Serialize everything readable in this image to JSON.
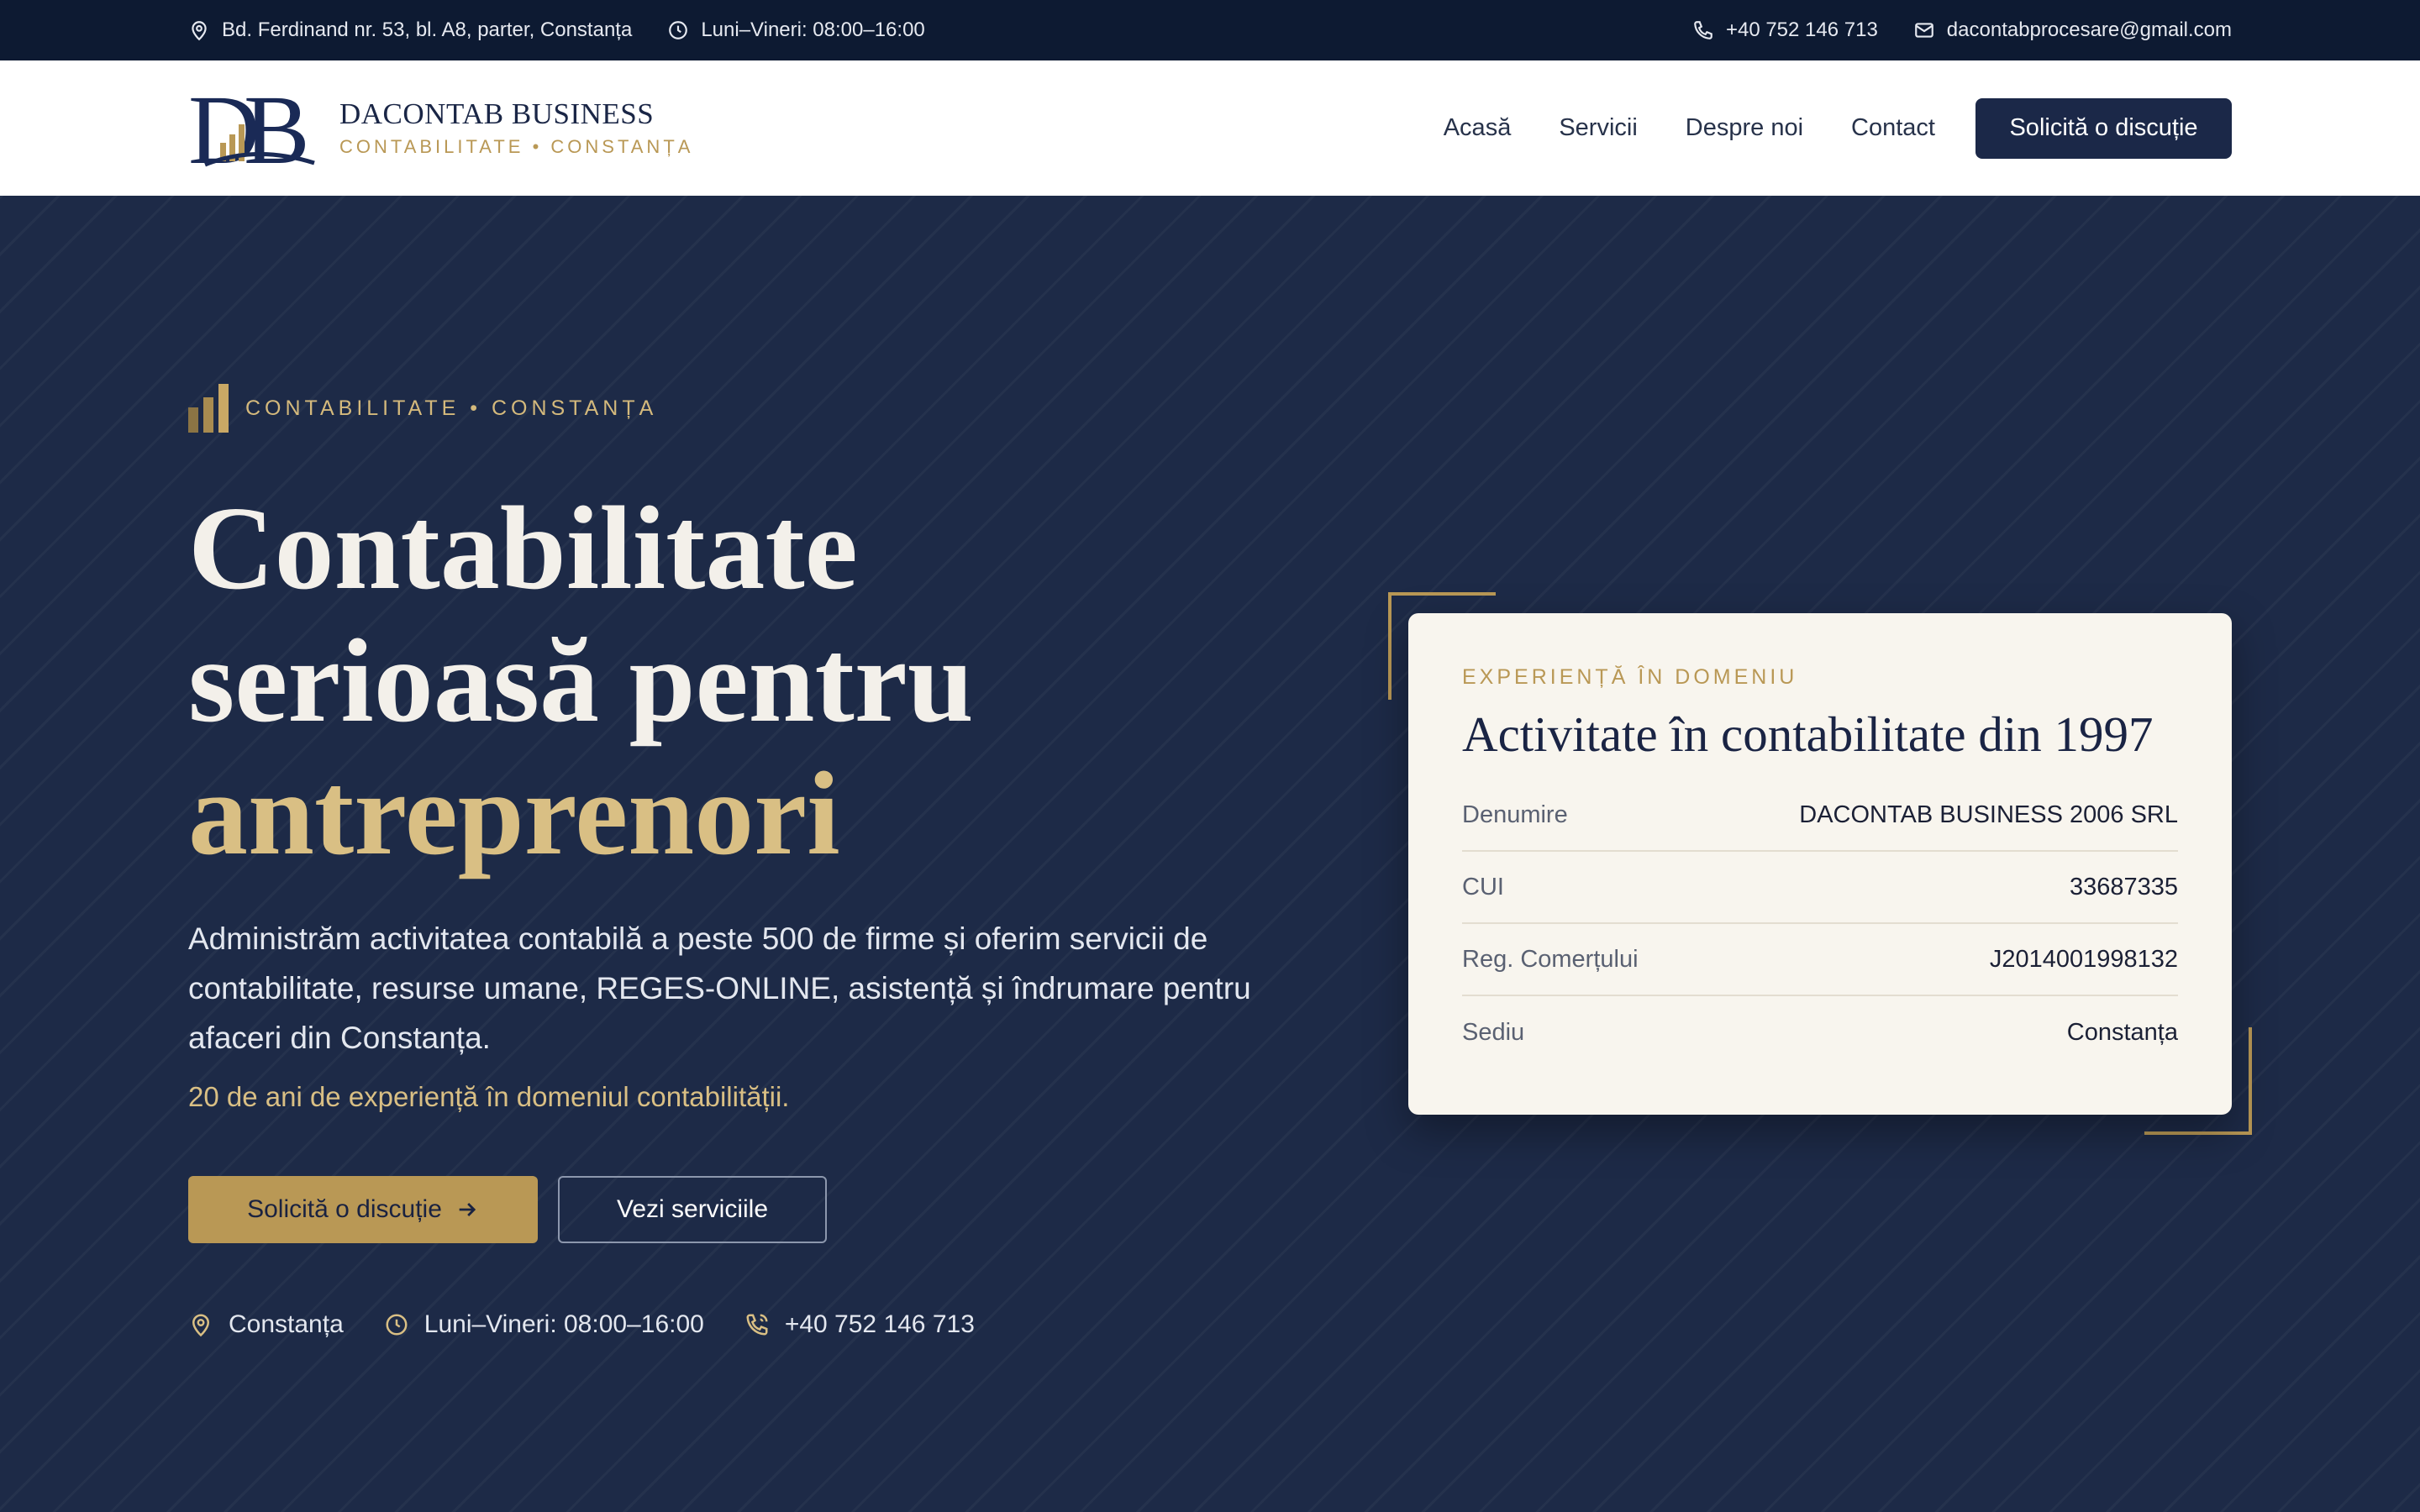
{
  "topbar": {
    "address": "Bd. Ferdinand nr. 53, bl. A8, parter, Constanța",
    "hours": "Luni–Vineri: 08:00–16:00",
    "phone": "+40 752 146 713",
    "email": "dacontabprocesare@gmail.com"
  },
  "header": {
    "brand_name": "DACONTAB BUSINESS",
    "brand_sub": "CONTABILITATE • CONSTANȚA",
    "nav": {
      "home": "Acasă",
      "services": "Servicii",
      "about": "Despre noi",
      "contact": "Contact"
    },
    "cta": "Solicită o discuție"
  },
  "hero": {
    "kicker": "CONTABILITATE • CONSTANȚA",
    "title_line1": "Contabilitate",
    "title_line2": "serioasă pentru",
    "title_line3": "antreprenori",
    "lead": "Administrăm activitatea contabilă a peste 500 de firme și oferim servicii de contabilitate, resurse umane, REGES-ONLINE, asistență și îndrumare pentru afaceri din Constanța.",
    "experience": "20 de ani de experiență în domeniul contabilității.",
    "primary_button": "Solicită o discuție",
    "secondary_button": "Vezi serviciile",
    "meta": {
      "city": "Constanța",
      "hours": "Luni–Vineri: 08:00–16:00",
      "phone": "+40 752 146 713"
    }
  },
  "card": {
    "kicker": "EXPERIENȚĂ ÎN DOMENIU",
    "title": "Activitate în contabilitate din 1997",
    "rows": [
      {
        "label": "Denumire",
        "value": "DACONTAB BUSINESS 2006 SRL"
      },
      {
        "label": "CUI",
        "value": "33687335"
      },
      {
        "label": "Reg. Comerțului",
        "value": "J2014001998132"
      },
      {
        "label": "Sediu",
        "value": "Constanța"
      }
    ]
  },
  "colors": {
    "navy": "#1d2a47",
    "navy_dark": "#0d1a32",
    "gold": "#b99855",
    "gold_light": "#d9bf84",
    "card_bg": "#f8f5ee"
  },
  "icons": [
    "pin-icon",
    "clock-icon",
    "phone-icon",
    "mail-icon",
    "bars-icon",
    "arrow-right-icon",
    "phone-call-icon"
  ]
}
